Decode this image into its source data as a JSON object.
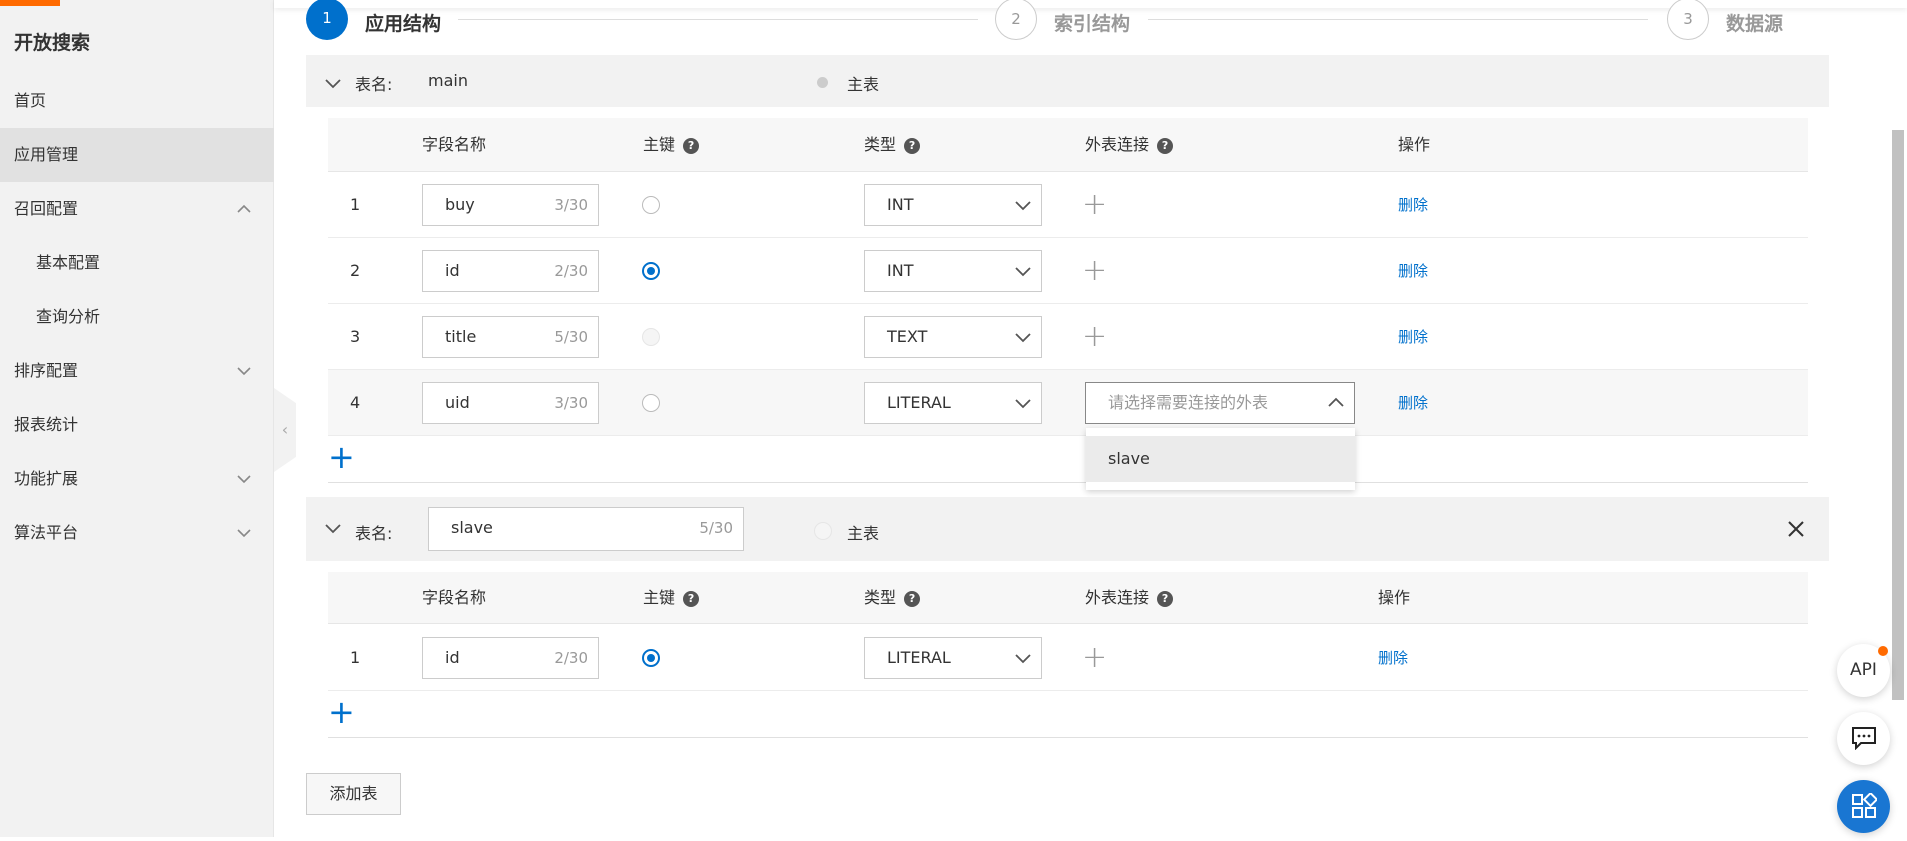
{
  "sidebar": {
    "title": "开放搜索",
    "items": [
      {
        "label": "首页"
      },
      {
        "label": "应用管理"
      },
      {
        "label": "召回配置"
      },
      {
        "label": "基本配置"
      },
      {
        "label": "查询分析"
      },
      {
        "label": "排序配置"
      },
      {
        "label": "报表统计"
      },
      {
        "label": "功能扩展"
      },
      {
        "label": "算法平台"
      }
    ]
  },
  "steps": [
    {
      "num": "1",
      "label": "应用结构"
    },
    {
      "num": "2",
      "label": "索引结构"
    },
    {
      "num": "3",
      "label": "数据源"
    }
  ],
  "table_name_label": "表名:",
  "primary_table_label": "主表",
  "columns": {
    "field": "字段名称",
    "pk": "主键",
    "type": "类型",
    "fk": "外表连接",
    "op": "操作",
    "help": "?"
  },
  "main": {
    "name": "main",
    "rows": [
      {
        "n": "1",
        "field": "buy",
        "count": "3/30",
        "type": "INT",
        "del": "删除"
      },
      {
        "n": "2",
        "field": "id",
        "count": "2/30",
        "type": "INT",
        "del": "删除"
      },
      {
        "n": "3",
        "field": "title",
        "count": "5/30",
        "type": "TEXT",
        "del": "删除"
      },
      {
        "n": "4",
        "field": "uid",
        "count": "3/30",
        "type": "LITERAL",
        "del": "删除"
      }
    ]
  },
  "fk_select": {
    "placeholder": "请选择需要连接的外表",
    "option": "slave"
  },
  "slave": {
    "name": "slave",
    "count": "5/30",
    "rows": [
      {
        "n": "1",
        "field": "id",
        "count": "2/30",
        "type": "LITERAL",
        "del": "删除"
      }
    ]
  },
  "add_table": "添加表",
  "fab_api": "API",
  "add_plus": "+",
  "fk_plus": "+"
}
